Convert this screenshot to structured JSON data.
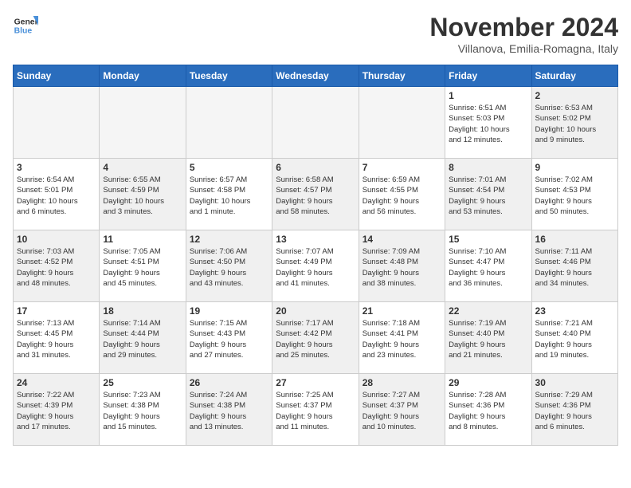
{
  "header": {
    "logo_line1": "General",
    "logo_line2": "Blue",
    "month_title": "November 2024",
    "location": "Villanova, Emilia-Romagna, Italy"
  },
  "days_of_week": [
    "Sunday",
    "Monday",
    "Tuesday",
    "Wednesday",
    "Thursday",
    "Friday",
    "Saturday"
  ],
  "weeks": [
    [
      {
        "day": "",
        "info": "",
        "empty": true
      },
      {
        "day": "",
        "info": "",
        "empty": true
      },
      {
        "day": "",
        "info": "",
        "empty": true
      },
      {
        "day": "",
        "info": "",
        "empty": true
      },
      {
        "day": "",
        "info": "",
        "empty": true
      },
      {
        "day": "1",
        "info": "Sunrise: 6:51 AM\nSunset: 5:03 PM\nDaylight: 10 hours\nand 12 minutes.",
        "empty": false
      },
      {
        "day": "2",
        "info": "Sunrise: 6:53 AM\nSunset: 5:02 PM\nDaylight: 10 hours\nand 9 minutes.",
        "empty": false
      }
    ],
    [
      {
        "day": "3",
        "info": "Sunrise: 6:54 AM\nSunset: 5:01 PM\nDaylight: 10 hours\nand 6 minutes.",
        "empty": false
      },
      {
        "day": "4",
        "info": "Sunrise: 6:55 AM\nSunset: 4:59 PM\nDaylight: 10 hours\nand 3 minutes.",
        "empty": false
      },
      {
        "day": "5",
        "info": "Sunrise: 6:57 AM\nSunset: 4:58 PM\nDaylight: 10 hours\nand 1 minute.",
        "empty": false
      },
      {
        "day": "6",
        "info": "Sunrise: 6:58 AM\nSunset: 4:57 PM\nDaylight: 9 hours\nand 58 minutes.",
        "empty": false
      },
      {
        "day": "7",
        "info": "Sunrise: 6:59 AM\nSunset: 4:55 PM\nDaylight: 9 hours\nand 56 minutes.",
        "empty": false
      },
      {
        "day": "8",
        "info": "Sunrise: 7:01 AM\nSunset: 4:54 PM\nDaylight: 9 hours\nand 53 minutes.",
        "empty": false
      },
      {
        "day": "9",
        "info": "Sunrise: 7:02 AM\nSunset: 4:53 PM\nDaylight: 9 hours\nand 50 minutes.",
        "empty": false
      }
    ],
    [
      {
        "day": "10",
        "info": "Sunrise: 7:03 AM\nSunset: 4:52 PM\nDaylight: 9 hours\nand 48 minutes.",
        "empty": false
      },
      {
        "day": "11",
        "info": "Sunrise: 7:05 AM\nSunset: 4:51 PM\nDaylight: 9 hours\nand 45 minutes.",
        "empty": false
      },
      {
        "day": "12",
        "info": "Sunrise: 7:06 AM\nSunset: 4:50 PM\nDaylight: 9 hours\nand 43 minutes.",
        "empty": false
      },
      {
        "day": "13",
        "info": "Sunrise: 7:07 AM\nSunset: 4:49 PM\nDaylight: 9 hours\nand 41 minutes.",
        "empty": false
      },
      {
        "day": "14",
        "info": "Sunrise: 7:09 AM\nSunset: 4:48 PM\nDaylight: 9 hours\nand 38 minutes.",
        "empty": false
      },
      {
        "day": "15",
        "info": "Sunrise: 7:10 AM\nSunset: 4:47 PM\nDaylight: 9 hours\nand 36 minutes.",
        "empty": false
      },
      {
        "day": "16",
        "info": "Sunrise: 7:11 AM\nSunset: 4:46 PM\nDaylight: 9 hours\nand 34 minutes.",
        "empty": false
      }
    ],
    [
      {
        "day": "17",
        "info": "Sunrise: 7:13 AM\nSunset: 4:45 PM\nDaylight: 9 hours\nand 31 minutes.",
        "empty": false
      },
      {
        "day": "18",
        "info": "Sunrise: 7:14 AM\nSunset: 4:44 PM\nDaylight: 9 hours\nand 29 minutes.",
        "empty": false
      },
      {
        "day": "19",
        "info": "Sunrise: 7:15 AM\nSunset: 4:43 PM\nDaylight: 9 hours\nand 27 minutes.",
        "empty": false
      },
      {
        "day": "20",
        "info": "Sunrise: 7:17 AM\nSunset: 4:42 PM\nDaylight: 9 hours\nand 25 minutes.",
        "empty": false
      },
      {
        "day": "21",
        "info": "Sunrise: 7:18 AM\nSunset: 4:41 PM\nDaylight: 9 hours\nand 23 minutes.",
        "empty": false
      },
      {
        "day": "22",
        "info": "Sunrise: 7:19 AM\nSunset: 4:40 PM\nDaylight: 9 hours\nand 21 minutes.",
        "empty": false
      },
      {
        "day": "23",
        "info": "Sunrise: 7:21 AM\nSunset: 4:40 PM\nDaylight: 9 hours\nand 19 minutes.",
        "empty": false
      }
    ],
    [
      {
        "day": "24",
        "info": "Sunrise: 7:22 AM\nSunset: 4:39 PM\nDaylight: 9 hours\nand 17 minutes.",
        "empty": false
      },
      {
        "day": "25",
        "info": "Sunrise: 7:23 AM\nSunset: 4:38 PM\nDaylight: 9 hours\nand 15 minutes.",
        "empty": false
      },
      {
        "day": "26",
        "info": "Sunrise: 7:24 AM\nSunset: 4:38 PM\nDaylight: 9 hours\nand 13 minutes.",
        "empty": false
      },
      {
        "day": "27",
        "info": "Sunrise: 7:25 AM\nSunset: 4:37 PM\nDaylight: 9 hours\nand 11 minutes.",
        "empty": false
      },
      {
        "day": "28",
        "info": "Sunrise: 7:27 AM\nSunset: 4:37 PM\nDaylight: 9 hours\nand 10 minutes.",
        "empty": false
      },
      {
        "day": "29",
        "info": "Sunrise: 7:28 AM\nSunset: 4:36 PM\nDaylight: 9 hours\nand 8 minutes.",
        "empty": false
      },
      {
        "day": "30",
        "info": "Sunrise: 7:29 AM\nSunset: 4:36 PM\nDaylight: 9 hours\nand 6 minutes.",
        "empty": false
      }
    ]
  ]
}
